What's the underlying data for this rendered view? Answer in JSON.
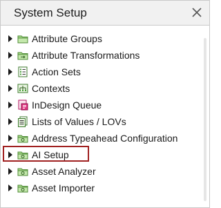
{
  "dialog": {
    "title": "System Setup",
    "close_icon": "close-icon"
  },
  "tree": {
    "items": [
      {
        "label": "Attribute Groups",
        "icon": "folder-icon"
      },
      {
        "label": "Attribute Transformations",
        "icon": "transform-folder-icon"
      },
      {
        "label": "Action Sets",
        "icon": "action-list-icon"
      },
      {
        "label": "Contexts",
        "icon": "contexts-icon"
      },
      {
        "label": "InDesign Queue",
        "icon": "indesign-queue-icon"
      },
      {
        "label": "Lists of Values / LOVs",
        "icon": "list-icon"
      },
      {
        "label": "Address Typeahead Configuration",
        "icon": "config-folder-icon"
      },
      {
        "label": "AI Setup",
        "icon": "config-folder-icon",
        "highlighted": true
      },
      {
        "label": "Asset Analyzer",
        "icon": "config-folder-icon"
      },
      {
        "label": "Asset Importer",
        "icon": "config-folder-icon"
      }
    ]
  },
  "colors": {
    "highlight_border": "#a02020",
    "folder_green": "#9ccf7b",
    "header_bg": "#f1f1f1"
  }
}
